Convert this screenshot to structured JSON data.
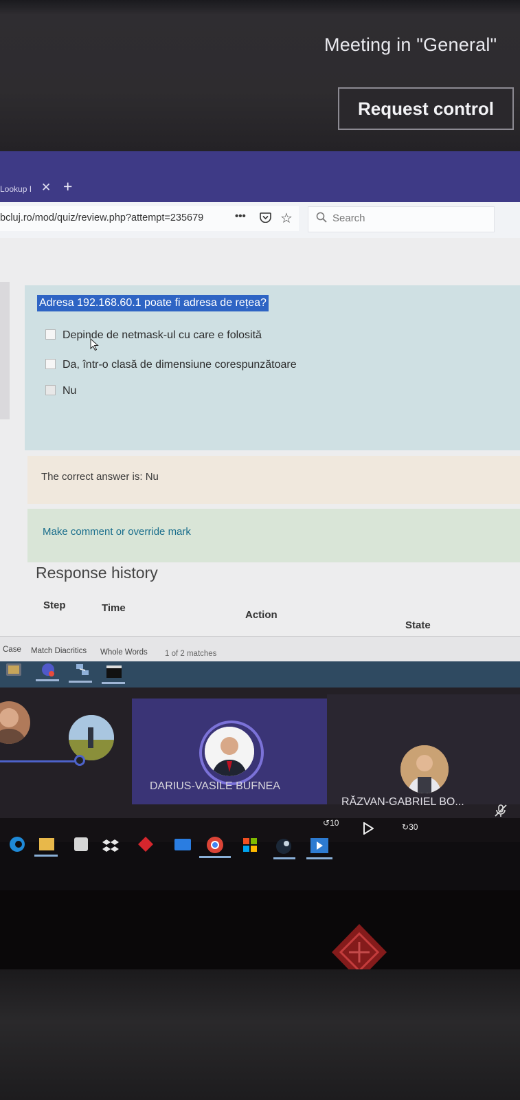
{
  "teams": {
    "meeting_title": "Meeting in \"General\"",
    "request_control_label": "Request control"
  },
  "browser": {
    "tab_title": "Lookup I",
    "address": "bcluj.ro/mod/quiz/review.php?attempt=235679",
    "search_placeholder": "Search"
  },
  "quiz": {
    "question": "Adresa 192.168.60.1 poate fi adresa de rețea?",
    "options": [
      {
        "label": "Depinde de netmask-ul cu care e folosită",
        "checked": false
      },
      {
        "label": "Da, într-o clasă de dimensiune corespunzătoare",
        "checked": false
      },
      {
        "label": "Nu",
        "checked": true
      }
    ],
    "correct_answer_text": "The correct answer is: Nu",
    "comment_link": "Make comment or override mark",
    "response_history_heading": "Response history",
    "history_columns": [
      "Step",
      "Time",
      "Action",
      "State"
    ]
  },
  "findbar": {
    "case_label": "Case",
    "diacritics_label": "Match Diacritics",
    "whole_words_label": "Whole Words",
    "matches_text": "1 of 2 matches"
  },
  "participants": {
    "speaker_name": "DARIUS-VASILE BUFNEA",
    "other_name": "RĂZVAN-GABRIEL BO..."
  },
  "media": {
    "rewind_label": "10",
    "forward_label": "30"
  },
  "colors": {
    "teams_purple": "#3e3a86",
    "question_highlight": "#2e64c4",
    "question_bg": "#cfe0e3",
    "feedback_bg": "#f0e8dd",
    "comment_bg": "#d9e5d7"
  }
}
